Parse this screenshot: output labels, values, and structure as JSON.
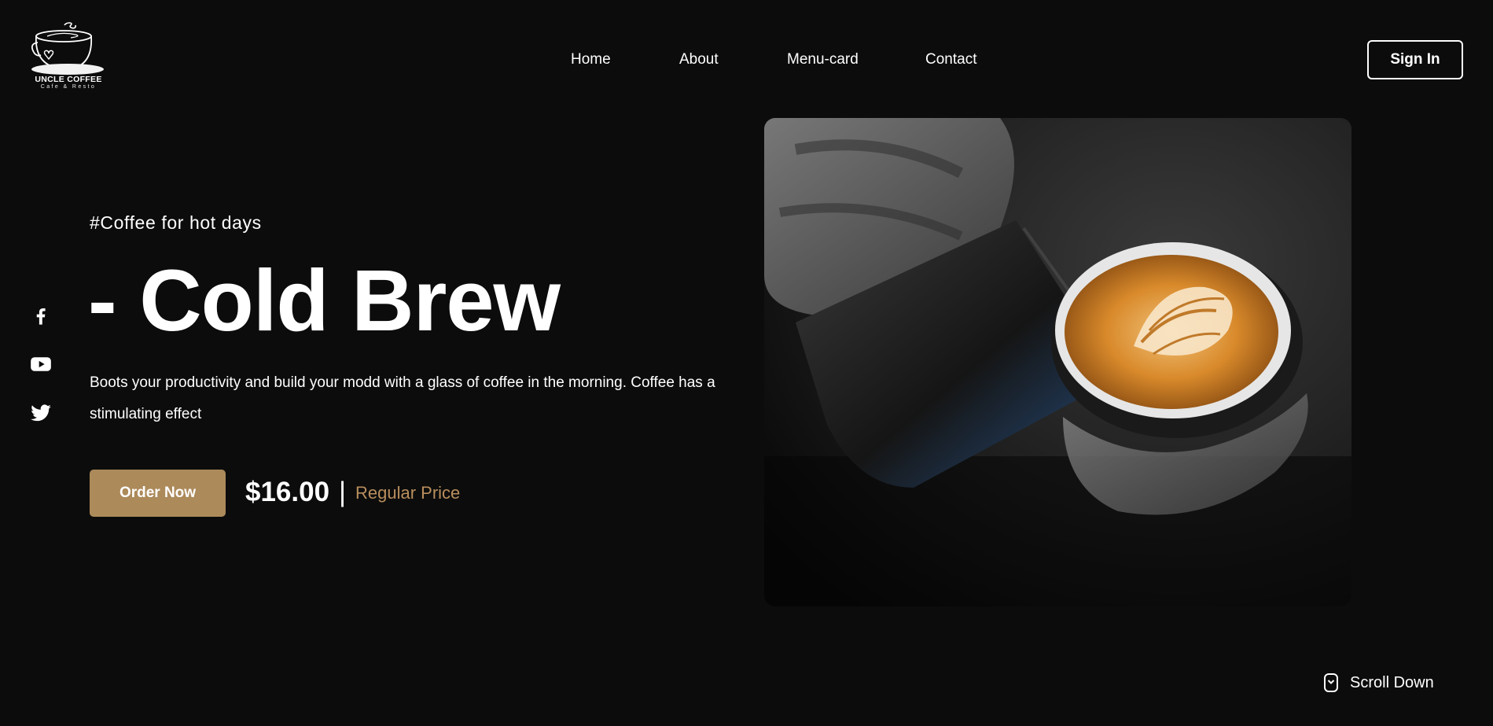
{
  "brand": {
    "name": "UNCLE COFFEE",
    "subtitle": "Cafe & Resto",
    "icon": "coffee-cup-logo"
  },
  "nav": {
    "items": [
      {
        "label": "Home"
      },
      {
        "label": "About"
      },
      {
        "label": "Menu-card"
      },
      {
        "label": "Contact"
      }
    ],
    "signin_label": "Sign In"
  },
  "social": [
    {
      "icon": "facebook-icon"
    },
    {
      "icon": "youtube-icon"
    },
    {
      "icon": "twitter-icon"
    }
  ],
  "hero": {
    "tagline": "#Coffee for hot days",
    "headline": "- Cold Brew",
    "description": "Boots your productivity and build your modd with a glass of coffee in the morning. Coffee has a stimulating effect",
    "order_label": "Order Now",
    "price": "$16.00",
    "price_separator": "|",
    "price_label": "Regular Price",
    "image_icon": "latte-art-photo"
  },
  "scroll": {
    "label": "Scroll Down",
    "icon": "mouse-scroll-icon"
  },
  "colors": {
    "background": "#0c0c0c",
    "accent": "#ac8a5a",
    "accent_text": "#b88e5d",
    "text": "#ffffff"
  }
}
